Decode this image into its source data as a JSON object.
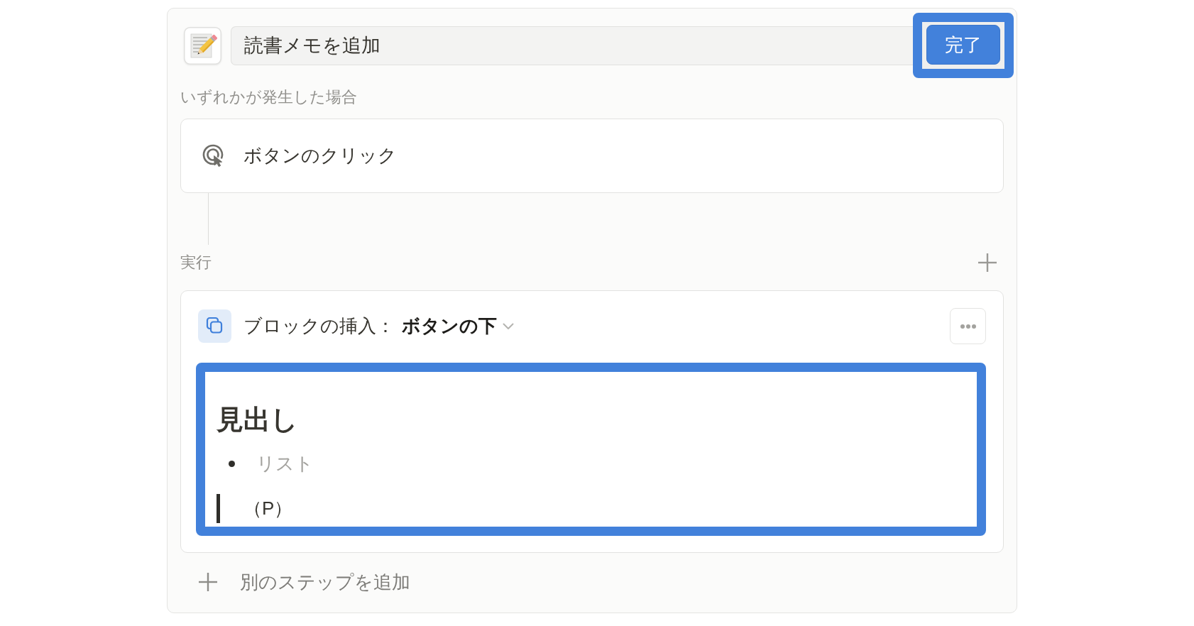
{
  "header": {
    "title_field": {
      "value": "読書メモを追加"
    },
    "done_button": {
      "label": "完了",
      "highlighted": true
    }
  },
  "trigger": {
    "label": "いずれかが発生した場合",
    "events": [
      {
        "label": "ボタンのクリック"
      }
    ]
  },
  "actions": {
    "label": "実行",
    "steps": [
      {
        "kind": "insert_blocks",
        "label": "ブロックの挿入：",
        "position": "ボタンの下",
        "highlighted": true,
        "blocks": [
          {
            "kind": "heading",
            "text": "見出し",
            "muted": false
          },
          {
            "kind": "bullet",
            "text": "リスト",
            "muted": true
          },
          {
            "kind": "quote",
            "text": "（P）",
            "muted": false
          }
        ]
      }
    ]
  },
  "add_step": {
    "label": "別のステップを追加"
  }
}
